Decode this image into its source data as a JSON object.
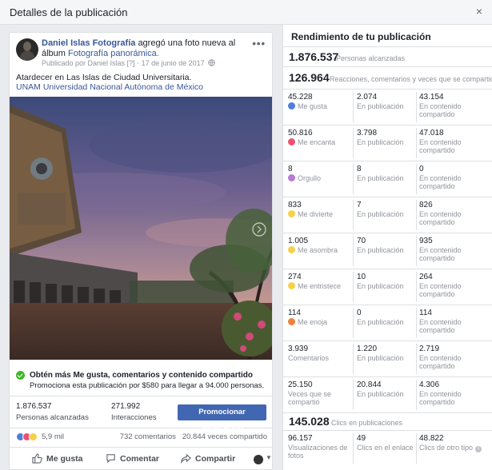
{
  "modal": {
    "title": "Detalles de la publicación",
    "close": "×"
  },
  "post": {
    "author": "Daniel Islas Fotografía",
    "action_text": "agregó una foto nueva al álbum",
    "album": "Fotografía panorámica.",
    "published_by": "Publicado por Daniel Islas",
    "published_q": "[?]",
    "date": "17 de junio de 2017",
    "caption": "Atardecer en Las Islas de Ciudad Universitaria.",
    "caption_link": "UNAM Universidad Nacional Autónoma de México"
  },
  "promo": {
    "title": "Obtén más Me gusta, comentarios y contenido compartido",
    "subtitle": "Promociona esta publicación por $580 para llegar a 94.000 personas."
  },
  "stats": {
    "reach_value": "1.876.537",
    "reach_label": "Personas alcanzadas",
    "interactions_value": "271.992",
    "interactions_label": "Interacciones",
    "promote_label": "Promocionar publicación"
  },
  "reactions_bar": {
    "count": "5,9 mil",
    "comments": "732 comentarios",
    "shares": "20.844 veces compartido"
  },
  "actions": {
    "like": "Me gusta",
    "comment": "Comentar",
    "share": "Compartir"
  },
  "insights": {
    "title": "Rendimiento de tu publicación",
    "reach_value": "1.876.537",
    "reach_label": "Personas alcanzadas",
    "engagement_value": "126.964",
    "engagement_label": "Reacciones, comentarios y veces que se compartió",
    "rows": [
      {
        "total": "45.228",
        "name": "Me gusta",
        "color": "#4f7ddb",
        "on_post": "2.074",
        "on_post_label": "En publicación",
        "shared": "43.154",
        "shared_label": "En contenido compartido"
      },
      {
        "total": "50.816",
        "name": "Me encanta",
        "color": "#f0506e",
        "on_post": "3.798",
        "on_post_label": "En publicación",
        "shared": "47.018",
        "shared_label": "En contenido compartido"
      },
      {
        "total": "8",
        "name": "Orgullo",
        "color": "#b57ad6",
        "on_post": "8",
        "on_post_label": "En publicación",
        "shared": "0",
        "shared_label": "En contenido compartido"
      },
      {
        "total": "833",
        "name": "Me divierte",
        "color": "#f7d04b",
        "on_post": "7",
        "on_post_label": "En publicación",
        "shared": "826",
        "shared_label": "En contenido compartido"
      },
      {
        "total": "1.005",
        "name": "Me asombra",
        "color": "#f7d04b",
        "on_post": "70",
        "on_post_label": "En publicación",
        "shared": "935",
        "shared_label": "En contenido compartido"
      },
      {
        "total": "274",
        "name": "Me entristece",
        "color": "#f7d04b",
        "on_post": "10",
        "on_post_label": "En publicación",
        "shared": "264",
        "shared_label": "En contenido compartido"
      },
      {
        "total": "114",
        "name": "Me enoja",
        "color": "#f0803c",
        "on_post": "0",
        "on_post_label": "En publicación",
        "shared": "114",
        "shared_label": "En contenido compartido"
      },
      {
        "total": "3.939",
        "name": "Comentarios",
        "color": "",
        "on_post": "1.220",
        "on_post_label": "En publicación",
        "shared": "2.719",
        "shared_label": "En contenido compartido"
      },
      {
        "total": "25.150",
        "name": "Veces que se compartió",
        "color": "",
        "on_post": "20.844",
        "on_post_label": "En publicación",
        "shared": "4.306",
        "shared_label": "En contenido compartido"
      }
    ],
    "clicks_value": "145.028",
    "clicks_label": "Clics en publicaciones",
    "clicks": [
      {
        "value": "96.157",
        "label": "Visualizaciones de fotos"
      },
      {
        "value": "49",
        "label": "Clics en el enlace"
      },
      {
        "value": "48.822",
        "label": "Clics de otro tipo"
      }
    ]
  }
}
